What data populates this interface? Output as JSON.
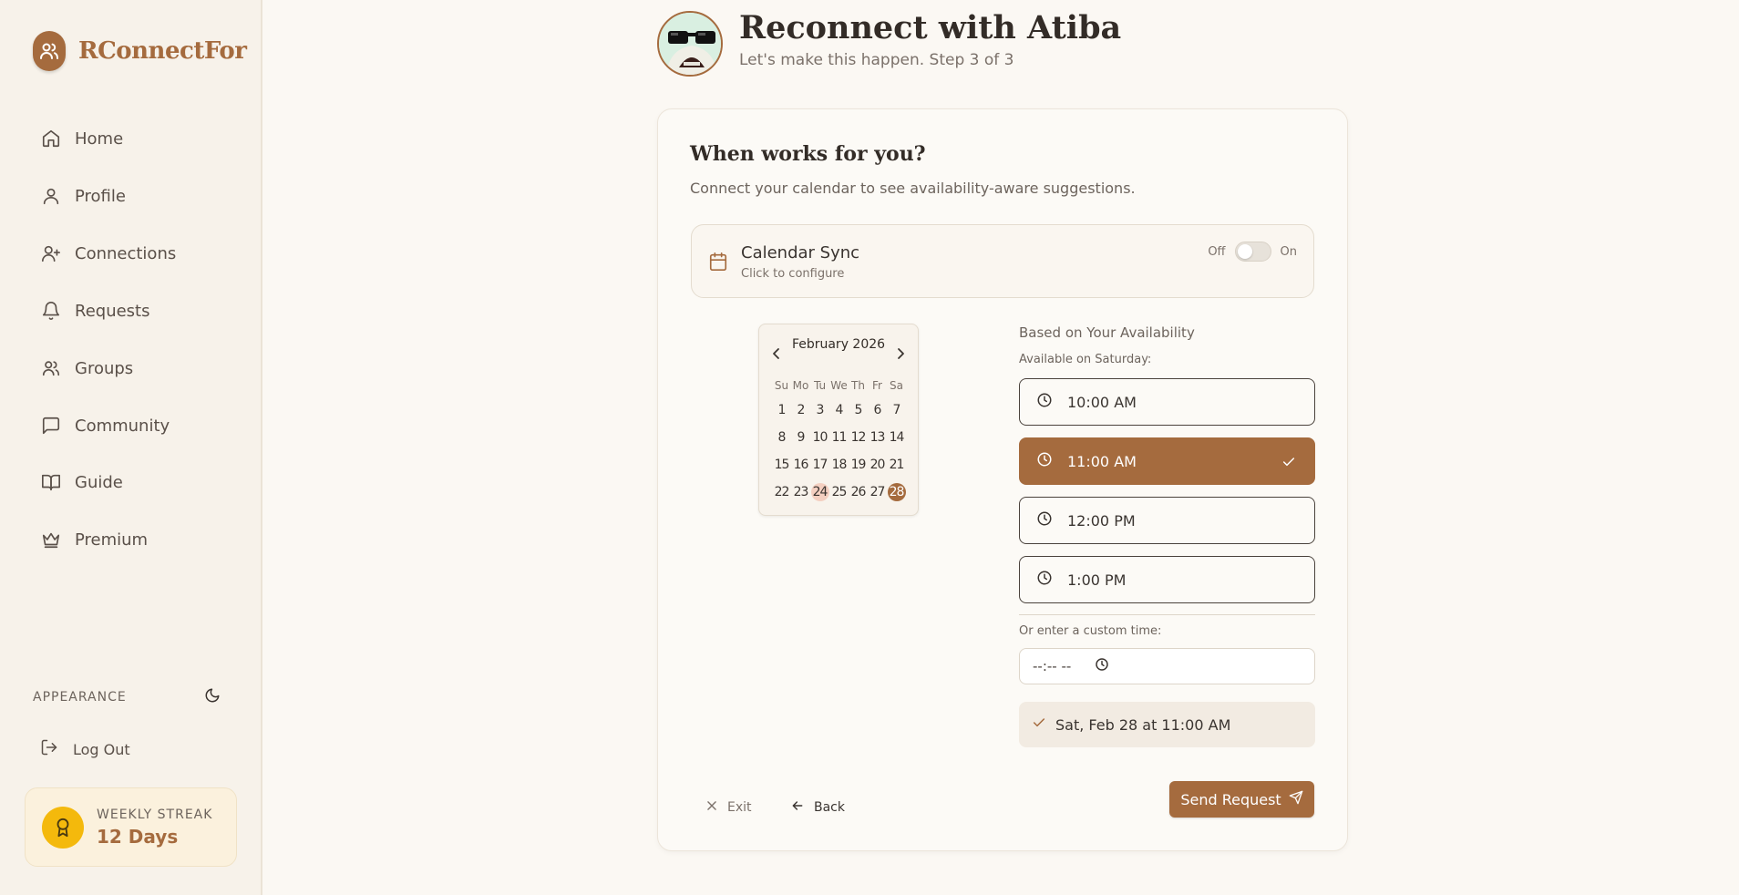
{
  "brand": {
    "name": "RConnectFor",
    "logo_icon": "users-icon"
  },
  "nav": [
    {
      "label": "Home",
      "icon": "home-icon"
    },
    {
      "label": "Profile",
      "icon": "user-icon"
    },
    {
      "label": "Connections",
      "icon": "user-plus-icon"
    },
    {
      "label": "Requests",
      "icon": "bell-icon"
    },
    {
      "label": "Groups",
      "icon": "users-icon"
    },
    {
      "label": "Community",
      "icon": "message-square-icon"
    },
    {
      "label": "Guide",
      "icon": "book-open-icon"
    },
    {
      "label": "Premium",
      "icon": "crown-icon"
    }
  ],
  "appearance": {
    "label": "APPEARANCE",
    "icon": "moon-icon"
  },
  "logout": {
    "label": "Log Out",
    "icon": "log-out-icon"
  },
  "streak": {
    "label": "WEEKLY STREAK",
    "value": "12 Days",
    "icon": "award-icon"
  },
  "header": {
    "title": "Reconnect with Atiba",
    "subtitle": "Let's make this happen. Step 3 of 3"
  },
  "card": {
    "title": "When works for you?",
    "description": "Connect your calendar to see availability-aware suggestions."
  },
  "calendar_sync": {
    "title": "Calendar Sync",
    "subtitle": "Click to configure",
    "off_label": "Off",
    "on_label": "On",
    "enabled": false
  },
  "calendar": {
    "month": "February 2026",
    "weekdays": [
      "Su",
      "Mo",
      "Tu",
      "We",
      "Th",
      "Fr",
      "Sa"
    ],
    "days": [
      [
        "1",
        "2",
        "3",
        "4",
        "5",
        "6",
        "7"
      ],
      [
        "8",
        "9",
        "10",
        "11",
        "12",
        "13",
        "14"
      ],
      [
        "15",
        "16",
        "17",
        "18",
        "19",
        "20",
        "21"
      ],
      [
        "22",
        "23",
        "24",
        "25",
        "26",
        "27",
        "28"
      ]
    ],
    "today": "24",
    "selected": "28"
  },
  "availability": {
    "title": "Based on Your Availability",
    "subtitle": "Available on Saturday:",
    "slots": [
      {
        "label": "10:00 AM",
        "selected": false
      },
      {
        "label": "11:00 AM",
        "selected": true
      },
      {
        "label": "12:00 PM",
        "selected": false
      },
      {
        "label": "1:00 PM",
        "selected": false
      }
    ],
    "custom_label": "Or enter a custom time:",
    "custom_placeholder": "--:-- --",
    "summary": "Sat, Feb 28 at 11:00 AM"
  },
  "actions": {
    "exit": "Exit",
    "back": "Back",
    "send": "Send Request"
  },
  "colors": {
    "accent": "#a56b3e",
    "background": "#fbf8f3",
    "sidebar": "#f7f2ea",
    "streak_badge": "#f4b90c"
  }
}
